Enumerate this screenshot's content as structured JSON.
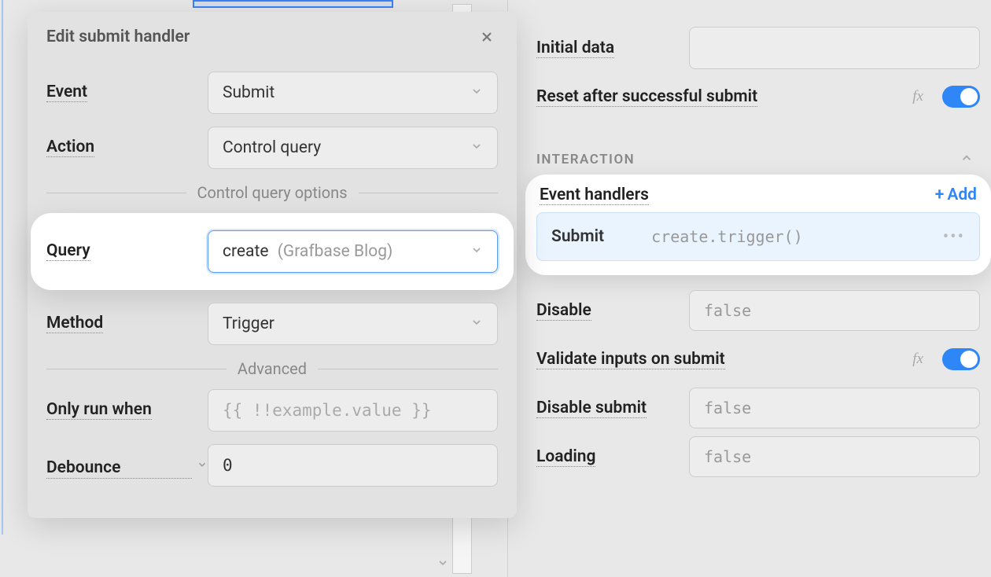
{
  "modal": {
    "title": "Edit submit handler",
    "sections": {
      "control_query": "Control query options",
      "advanced": "Advanced"
    },
    "fields": {
      "event": {
        "label": "Event",
        "value": "Submit"
      },
      "action": {
        "label": "Action",
        "value": "Control query"
      },
      "query": {
        "label": "Query",
        "value": "create",
        "secondary": "(Grafbase Blog)"
      },
      "method": {
        "label": "Method",
        "value": "Trigger"
      },
      "only_run_when": {
        "label": "Only run when",
        "placeholder": "{{ !!example.value }}"
      },
      "debounce": {
        "label": "Debounce",
        "value": "0"
      }
    }
  },
  "right": {
    "initial_data": {
      "label": "Initial data"
    },
    "reset_after_submit": {
      "label": "Reset after successful submit",
      "toggle": true
    },
    "section_header": "INTERACTION",
    "event_handlers": {
      "label": "Event handlers",
      "add_label": "Add",
      "items": [
        {
          "event": "Submit",
          "code": "create.trigger()"
        }
      ]
    },
    "disable": {
      "label": "Disable",
      "value": "false"
    },
    "validate_inputs": {
      "label": "Validate inputs on submit",
      "toggle": true
    },
    "disable_submit": {
      "label": "Disable submit",
      "value": "false"
    },
    "loading": {
      "label": "Loading",
      "value": "false"
    }
  },
  "glyphs": {
    "fx": "fx"
  }
}
